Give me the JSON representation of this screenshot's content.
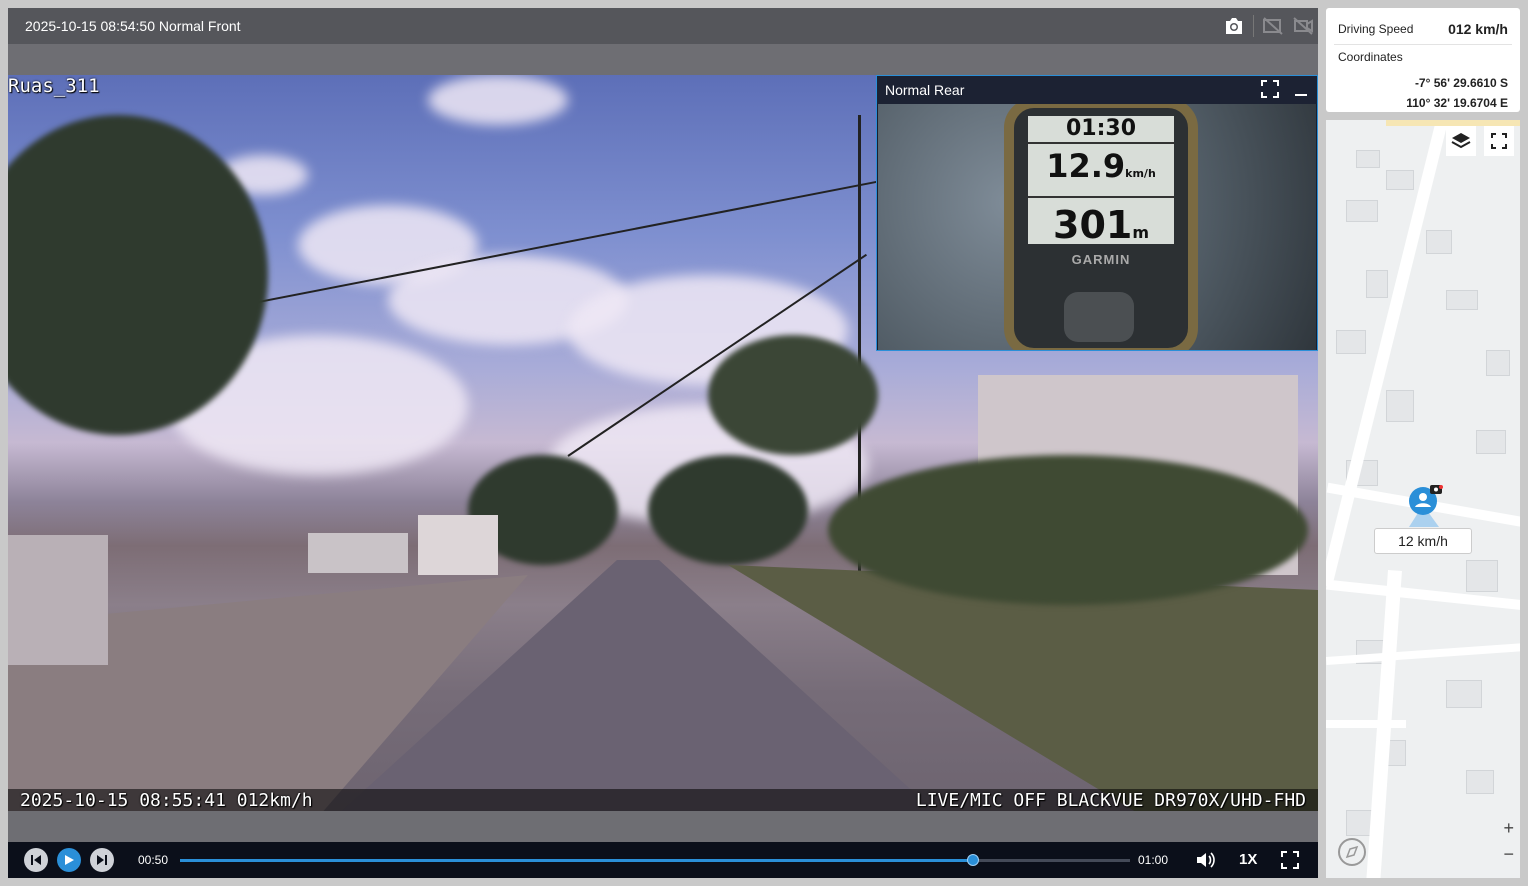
{
  "topbar": {
    "title": "2025-10-15 08:54:50 Normal Front",
    "icons": [
      "camera-icon",
      "pip-off-icon",
      "mute-camera-icon"
    ]
  },
  "video": {
    "overlay_top": "Ruas_311",
    "overlay_bottom_left": "2025-10-15 08:55:41 012km/h",
    "overlay_bottom_right": "LIVE/MIC OFF BLACKVUE DR970X/UHD-FHD"
  },
  "rear": {
    "title": "Normal Rear",
    "gps_time": "01:30",
    "gps_speed": "12.9",
    "gps_speed_unit": "km/h",
    "gps_distance": "301",
    "gps_distance_unit": "m",
    "gps_brand": "GARMIN"
  },
  "controls": {
    "current_time": "00:50",
    "end_time": "01:00",
    "progress": 0.835,
    "speed": "1X"
  },
  "side": {
    "driving_speed_label": "Driving Speed",
    "driving_speed_value": "012 km/h",
    "coordinates_label": "Coordinates",
    "latitude": "-7° 56' 29.6610 S",
    "longitude": "110° 32' 19.6704 E"
  },
  "map": {
    "speed_tag": "12 km/h",
    "zoom_in": "+",
    "zoom_out": "−"
  },
  "colors": {
    "accent": "#2a8fd8",
    "topbar": "#55565b",
    "controls": "#0b0f1a"
  }
}
